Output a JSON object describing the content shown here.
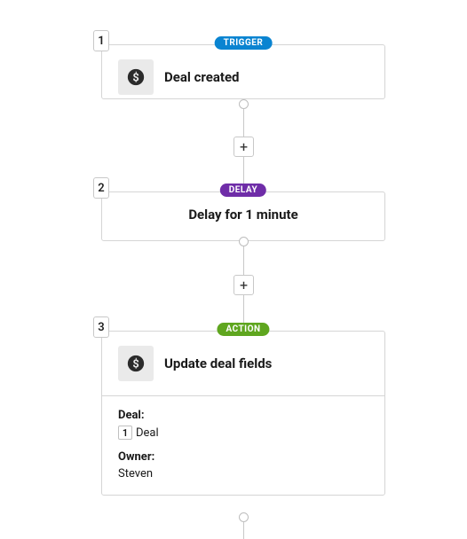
{
  "steps": [
    {
      "number": "1",
      "badge": "TRIGGER",
      "title": "Deal created",
      "hasIcon": true,
      "details": []
    },
    {
      "number": "2",
      "badge": "DELAY",
      "title": "Delay for 1 minute",
      "hasIcon": false,
      "details": []
    },
    {
      "number": "3",
      "badge": "ACTION",
      "title": "Update deal fields",
      "hasIcon": true,
      "details": [
        {
          "label": "Deal:",
          "refChip": "1",
          "value": "Deal"
        },
        {
          "label": "Owner:",
          "refChip": null,
          "value": "Steven"
        }
      ]
    }
  ],
  "addButtonLabel": "+"
}
